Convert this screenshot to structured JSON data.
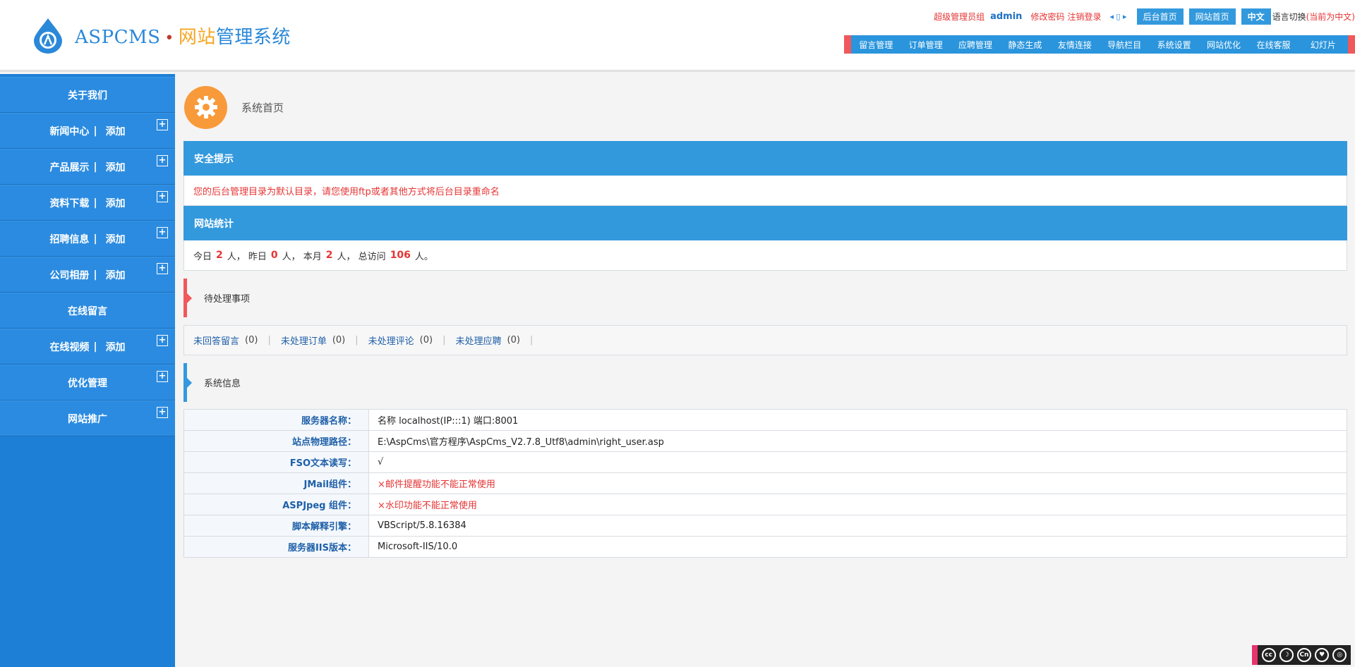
{
  "header": {
    "logo_text": "ASPCMS",
    "logo_dot": "•",
    "logo_sys_1": "网站",
    "logo_sys_2": "管理系统",
    "user_group": "超级管理员组",
    "username": "admin",
    "change_password": "修改密码",
    "logout": "注销登录",
    "arrows": "◂ ▯ ▸",
    "backend_home": "后台首页",
    "site_home": "网站首页",
    "lang_current": "中文",
    "lang_switch": "语言切换",
    "lang_note": "(当前为中文)"
  },
  "nav": [
    "留言管理",
    "订单管理",
    "应聘管理",
    "静态生成",
    "友情连接",
    "导航栏目",
    "系统设置",
    "网站优化",
    "在线客服",
    "幻灯片"
  ],
  "sidebar": {
    "items": [
      {
        "label": "关于我们",
        "add": "",
        "plus": false
      },
      {
        "label": "新闻中心",
        "add": "添加",
        "plus": true
      },
      {
        "label": "产品展示",
        "add": "添加",
        "plus": true
      },
      {
        "label": "资料下载",
        "add": "添加",
        "plus": true
      },
      {
        "label": "招聘信息",
        "add": "添加",
        "plus": true
      },
      {
        "label": "公司相册",
        "add": "添加",
        "plus": true
      },
      {
        "label": "在线留言",
        "add": "",
        "plus": false
      },
      {
        "label": "在线视频",
        "add": "添加",
        "plus": true
      },
      {
        "label": "优化管理",
        "add": "",
        "plus": true
      },
      {
        "label": "网站推广",
        "add": "",
        "plus": true
      }
    ],
    "sep": "|",
    "plus_symbol": "+"
  },
  "main": {
    "home_title": "系统首页",
    "security": {
      "title": "安全提示",
      "message": "您的后台管理目录为默认目录，请您使用ftp或者其他方式将后台目录重命名"
    },
    "stats": {
      "title": "网站统计",
      "today_label": "今日",
      "today": "2",
      "yesterday_label": "人， 昨日",
      "yesterday": "0",
      "month_label": "人， 本月",
      "month": "2",
      "total_label": "人， 总访问",
      "total": "106",
      "end": "人。"
    },
    "pending": {
      "title": "待处理事项",
      "items": [
        {
          "label": "未回答留言",
          "count": "(0)"
        },
        {
          "label": "未处理订单",
          "count": "(0)"
        },
        {
          "label": "未处理评论",
          "count": "(0)"
        },
        {
          "label": "未处理应聘",
          "count": "(0)"
        }
      ],
      "pipe": "|"
    },
    "sysinfo": {
      "title": "系统信息",
      "rows": [
        {
          "k": "服务器名称：",
          "v": "名称 localhost(IP:::1) 端口:8001",
          "err": false
        },
        {
          "k": "站点物理路径：",
          "v": "E:\\AspCms\\官方程序\\AspCms_V2.7.8_Utf8\\admin\\right_user.asp",
          "err": false
        },
        {
          "k": "FSO文本读写：",
          "v": "√",
          "err": false
        },
        {
          "k": "JMail组件：",
          "v": "×邮件提醒功能不能正常使用",
          "err": true
        },
        {
          "k": "ASPJpeg 组件：",
          "v": "×水印功能不能正常使用",
          "err": true
        },
        {
          "k": "脚本解释引擎：",
          "v": "VBScript/5.8.16384",
          "err": false
        },
        {
          "k": "服务器IIS版本：",
          "v": "Microsoft-IIS/10.0",
          "err": false
        }
      ]
    }
  },
  "badge": {
    "icons": [
      "cc",
      "☽",
      "Cn",
      "♥",
      "◎"
    ]
  },
  "colors": {
    "primary": "#3399dd",
    "sidebar": "#1e7fd6",
    "warning": "#e63434",
    "accent": "#f0585b",
    "gear": "#f89a3a"
  }
}
